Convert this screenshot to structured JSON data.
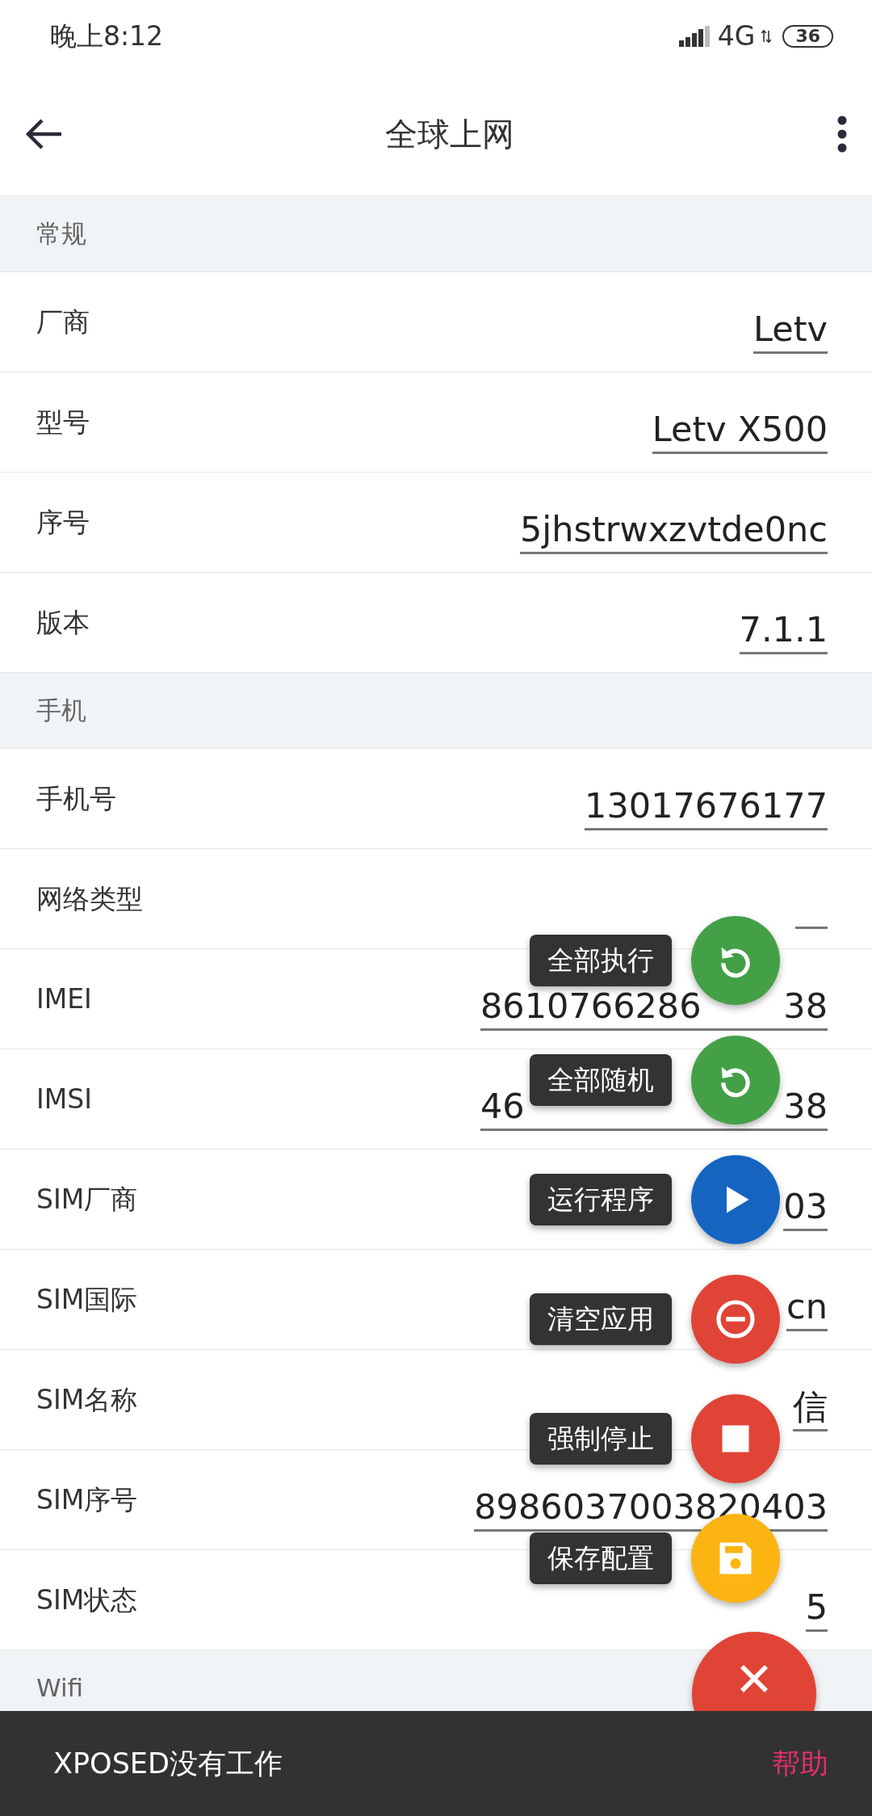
{
  "status_bar": {
    "time": "晚上8:12",
    "network": "4G",
    "battery": "36"
  },
  "toolbar": {
    "title": "全球上网"
  },
  "sections": [
    {
      "title": "常规",
      "rows": [
        {
          "label": "厂商",
          "value": "Letv"
        },
        {
          "label": "型号",
          "value": "Letv X500"
        },
        {
          "label": "序号",
          "value": "5jhstrwxzvtde0nc"
        },
        {
          "label": "版本",
          "value": "7.1.1"
        }
      ]
    },
    {
      "title": "手机",
      "rows": [
        {
          "label": "手机号",
          "value": "13017676177"
        },
        {
          "label": "网络类型"
        },
        {
          "label": "IMEI",
          "value": [
            "8610766286",
            "38"
          ]
        },
        {
          "label": "IMSI",
          "value": [
            "46",
            "38"
          ]
        },
        {
          "label": "SIM厂商",
          "value": "03"
        },
        {
          "label": "SIM国际",
          "value": "cn"
        },
        {
          "label": "SIM名称",
          "value": "信"
        },
        {
          "label": "SIM序号",
          "value": "8986037003820403"
        },
        {
          "label": "SIM状态",
          "value": "5"
        }
      ]
    },
    {
      "title": "Wifi"
    }
  ],
  "fab_menu": {
    "actions": [
      {
        "label": "全部执行",
        "kind": "restore",
        "color": "#43a047"
      },
      {
        "label": "全部随机",
        "kind": "restore",
        "color": "#43a047"
      },
      {
        "label": "运行程序",
        "kind": "play",
        "color": "#1565c0"
      },
      {
        "label": "清空应用",
        "kind": "remove",
        "color": "#e04436"
      },
      {
        "label": "强制停止",
        "kind": "stop",
        "color": "#e04436"
      },
      {
        "label": "保存配置",
        "kind": "save",
        "color": "#fbb412"
      }
    ],
    "main": {
      "kind": "close",
      "color": "#e04436"
    }
  },
  "snackbar": {
    "message": "XPOSED没有工作",
    "action": "帮助"
  }
}
